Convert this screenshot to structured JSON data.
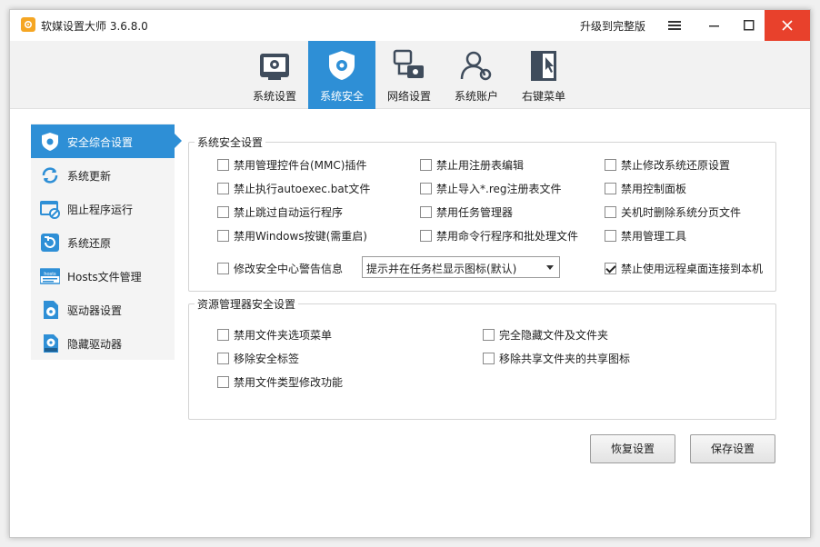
{
  "window": {
    "title": "软媒设置大师 3.6.8.0",
    "upgrade_label": "升级到完整版"
  },
  "tabs": [
    {
      "label": "系统设置",
      "icon": "system-settings-icon",
      "active": false
    },
    {
      "label": "系统安全",
      "icon": "security-shield-icon",
      "active": true
    },
    {
      "label": "网络设置",
      "icon": "network-icon",
      "active": false
    },
    {
      "label": "系统账户",
      "icon": "user-accounts-icon",
      "active": false
    },
    {
      "label": "右键菜单",
      "icon": "context-menu-icon",
      "active": false
    }
  ],
  "sidebar": {
    "items": [
      {
        "label": "安全综合设置",
        "icon": "shield-icon",
        "active": true
      },
      {
        "label": "系统更新",
        "icon": "update-icon",
        "active": false
      },
      {
        "label": "阻止程序运行",
        "icon": "block-program-icon",
        "active": false
      },
      {
        "label": "系统还原",
        "icon": "restore-icon",
        "active": false
      },
      {
        "label": "Hosts文件管理",
        "icon": "hosts-file-icon",
        "active": false
      },
      {
        "label": "驱动器设置",
        "icon": "drive-icon",
        "active": false
      },
      {
        "label": "隐藏驱动器",
        "icon": "hide-drive-icon",
        "active": false
      }
    ]
  },
  "security_group": {
    "title": "系统安全设置",
    "options": [
      {
        "label": "禁用管理控件台(MMC)插件",
        "checked": false
      },
      {
        "label": "禁止用注册表编辑",
        "checked": false
      },
      {
        "label": "禁止修改系统还原设置",
        "checked": false
      },
      {
        "label": "禁止执行autoexec.bat文件",
        "checked": false
      },
      {
        "label": "禁止导入*.reg注册表文件",
        "checked": false
      },
      {
        "label": "禁用控制面板",
        "checked": false
      },
      {
        "label": "禁止跳过自动运行程序",
        "checked": false
      },
      {
        "label": "禁用任务管理器",
        "checked": false
      },
      {
        "label": "关机时删除系统分页文件",
        "checked": false
      },
      {
        "label": "禁用Windows按键(需重启)",
        "checked": false
      },
      {
        "label": "禁用命令行程序和批处理文件",
        "checked": false
      },
      {
        "label": "禁用管理工具",
        "checked": false
      }
    ],
    "security_center": {
      "label": "修改安全中心警告信息",
      "checked": false
    },
    "security_center_select": "提示并在任务栏显示图标(默认)",
    "remote_desktop": {
      "label": "禁止使用远程桌面连接到本机",
      "checked": true
    }
  },
  "explorer_group": {
    "title": "资源管理器安全设置",
    "options": [
      {
        "label": "禁用文件夹选项菜单",
        "checked": false
      },
      {
        "label": "完全隐藏文件及文件夹",
        "checked": false
      },
      {
        "label": "移除安全标签",
        "checked": false
      },
      {
        "label": "移除共享文件夹的共享图标",
        "checked": false
      },
      {
        "label": "禁用文件类型修改功能",
        "checked": false
      }
    ]
  },
  "buttons": {
    "restore_label": "恢复设置",
    "save_label": "保存设置"
  },
  "colors": {
    "accent": "#2e8fd6",
    "close": "#e8412c",
    "app_icon": "#f5a623"
  }
}
